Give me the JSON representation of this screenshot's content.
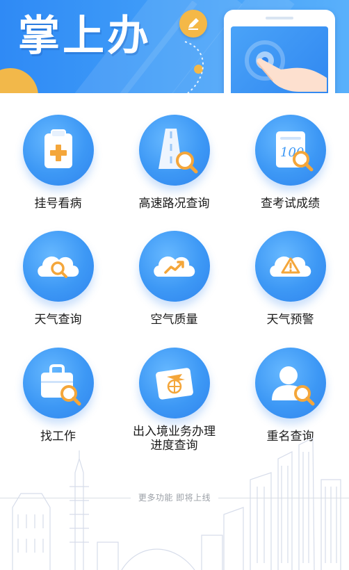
{
  "banner": {
    "title": "掌上办"
  },
  "services": [
    {
      "label": "挂号看病",
      "icon": "medical-clipboard-icon"
    },
    {
      "label": "高速路况查询",
      "icon": "highway-search-icon"
    },
    {
      "label": "查考试成绩",
      "icon": "exam-score-icon"
    },
    {
      "label": "天气查询",
      "icon": "weather-search-icon"
    },
    {
      "label": "空气质量",
      "icon": "air-quality-icon"
    },
    {
      "label": "天气预警",
      "icon": "weather-warning-icon"
    },
    {
      "label": "找工作",
      "icon": "briefcase-search-icon"
    },
    {
      "label_line1": "出入境业务办理",
      "label_line2": "进度查询",
      "icon": "passport-plane-icon"
    },
    {
      "label": "重名查询",
      "icon": "user-search-icon"
    }
  ],
  "footer": {
    "more_text": "更多功能 即将上线"
  },
  "colors": {
    "brand_blue": "#3d98f5",
    "accent_gold": "#f4b847"
  }
}
